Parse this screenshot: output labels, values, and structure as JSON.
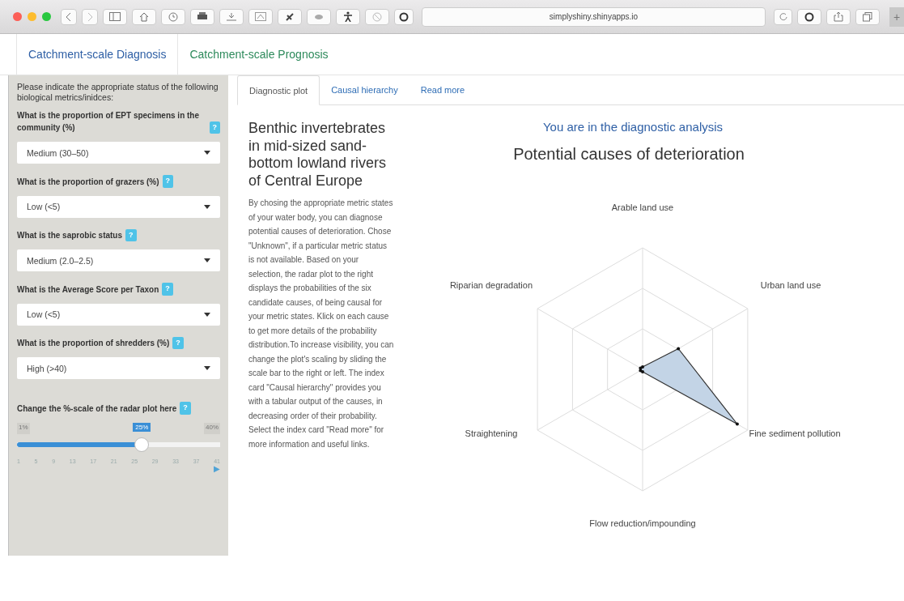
{
  "browser": {
    "url": "simplyshiny.shinyapps.io",
    "new_tab": "+"
  },
  "nav_tabs": [
    {
      "label": "Catchment-scale Diagnosis",
      "selected": true
    },
    {
      "label": "Catchment-scale Prognosis",
      "selected": false
    }
  ],
  "sidebar": {
    "intro": "Please indicate the appropriate status of the following biological metrics/inidces:",
    "questions": [
      {
        "label": "What is the proportion of EPT specimens in the community (%)",
        "help": "?",
        "value": "Medium (30–50)"
      },
      {
        "label": "What is the proportion of grazers (%)",
        "help": "?",
        "value": "Low (<5)"
      },
      {
        "label": "What is the saprobic status",
        "help": "?",
        "value": "Medium (2.0–2.5)"
      },
      {
        "label": "What is the Average Score per Taxon",
        "help": "?",
        "value": "Low (<5)"
      },
      {
        "label": "What is the proportion of shredders (%)",
        "help": "?",
        "value": "High (>40)"
      }
    ],
    "slider": {
      "label": "Change the %-scale of the radar plot here",
      "help": "?",
      "min_label": "1%",
      "max_label": "40%",
      "value_label": "25%",
      "level": 0.615,
      "ticks": [
        "1",
        "5",
        "9",
        "13",
        "17",
        "21",
        "25",
        "29",
        "33",
        "37",
        "41"
      ],
      "play": "▶"
    }
  },
  "content_tabs": [
    {
      "label": "Diagnostic plot",
      "selected": true
    },
    {
      "label": "Causal hierarchy",
      "selected": false
    },
    {
      "label": "Read more",
      "selected": false
    }
  ],
  "heading": "Benthic invertebrates in mid-sized sand-bottom lowland rivers of Central Europe",
  "description": "By chosing the appropriate metric states of your water body, you can diagnose potential causes of deterioration. Chose \"Unknown\", if a particular metric status is not available. Based on your selection, the radar plot to the right displays the probabilities of the six candidate causes, of being causal for your metric states. Klick on each cause to get more details of the probability distribution.To increase visibility, you can change the plot's scaling by sliding the scale bar to the right or left. The index card \"Causal hierarchy\" provides you with a tabular output of the causes, in decreasing order of their probability. Select the index card \"Read more\" for more information and useful links.",
  "analysis_label": "You are in the diagnostic analysis",
  "chart": {
    "title": "Potential causes of deterioration",
    "axes": [
      "Arable land use",
      "Urban land use",
      "Fine sediment pollution",
      "Flow reduction/impounding",
      "Straightening",
      "Riparian degradation"
    ]
  }
}
